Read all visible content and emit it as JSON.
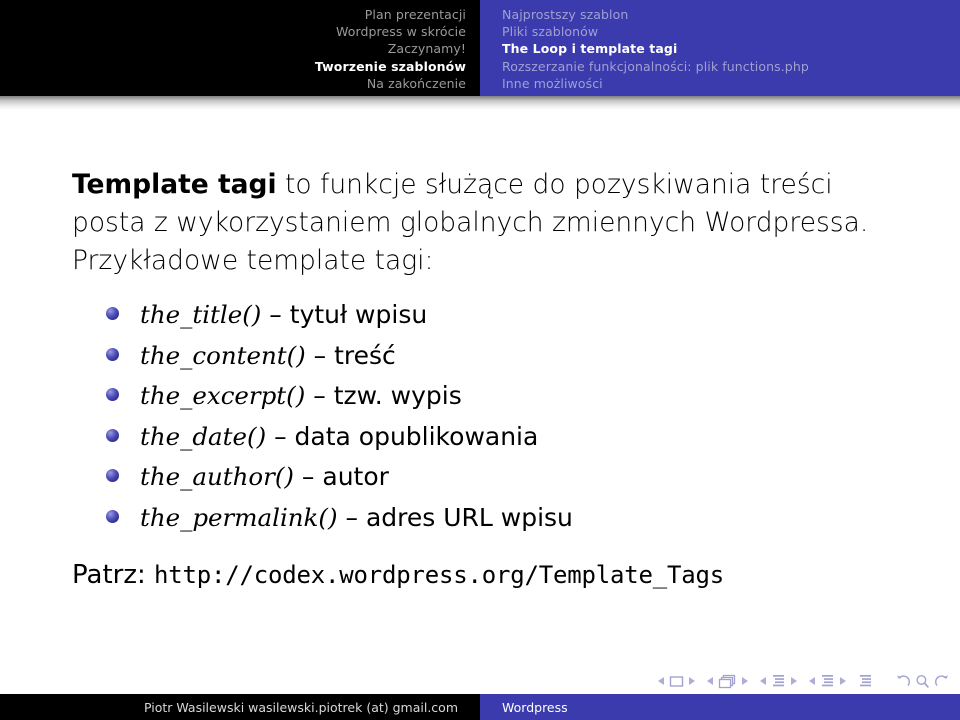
{
  "header": {
    "sections": [
      {
        "label": "Plan prezentacji",
        "active": false
      },
      {
        "label": "Wordpress w skrócie",
        "active": false
      },
      {
        "label": "Zaczynamy!",
        "active": false
      },
      {
        "label": "Tworzenie szablonów",
        "active": true
      },
      {
        "label": "Na zakończenie",
        "active": false
      }
    ],
    "subsections": [
      {
        "label": "Najprostszy szablon",
        "active": false
      },
      {
        "label": "Pliki szablonów",
        "active": false
      },
      {
        "label": "The Loop i template tagi",
        "active": true
      },
      {
        "label": "Rozszerzanie funkcjonalności: plik functions.php",
        "active": false
      },
      {
        "label": "Inne możliwości",
        "active": false
      }
    ],
    "left_bg": "#000000",
    "right_bg": "#3b3bad"
  },
  "main": {
    "paragraph_lead": "Template tagi",
    "paragraph_rest": " to funkcje służące do pozyskiwania treści posta z wykorzystaniem globalnych zmiennych Wordpressa.",
    "paragraph_two": "Przykładowe template tagi:",
    "bullets": [
      {
        "fn": "the_title()",
        "dash": " – ",
        "desc": "tytuł wpisu"
      },
      {
        "fn": "the_content()",
        "dash": " – ",
        "desc": "treść"
      },
      {
        "fn": "the_excerpt()",
        "dash": " – ",
        "desc": "tzw. wypis"
      },
      {
        "fn": "the_date()",
        "dash": " – ",
        "desc": "data opublikowania"
      },
      {
        "fn": "the_author()",
        "dash": " – ",
        "desc": "autor"
      },
      {
        "fn": "the_permalink()",
        "dash": " – ",
        "desc": "adres URL wpisu"
      }
    ],
    "reference_label": "Patrz: ",
    "reference_url": "http://codex.wordpress.org/Template_Tags"
  },
  "navsymbols": {
    "frame_prev": "◀",
    "frame_next": "▶",
    "slide_prev": "◀",
    "slide_next": "▶",
    "section_prev": "◀",
    "section_next": "▶",
    "subsection_prev": "◀",
    "subsection_next": "▶",
    "back_label": "back",
    "search_label": "search",
    "forward_label": "forward"
  },
  "footer": {
    "author": "Piotr Wasilewski wasilewski.piotrek (at) gmail.com",
    "title": "Wordpress",
    "left_bg": "#000000",
    "right_bg": "#3b3bad"
  }
}
